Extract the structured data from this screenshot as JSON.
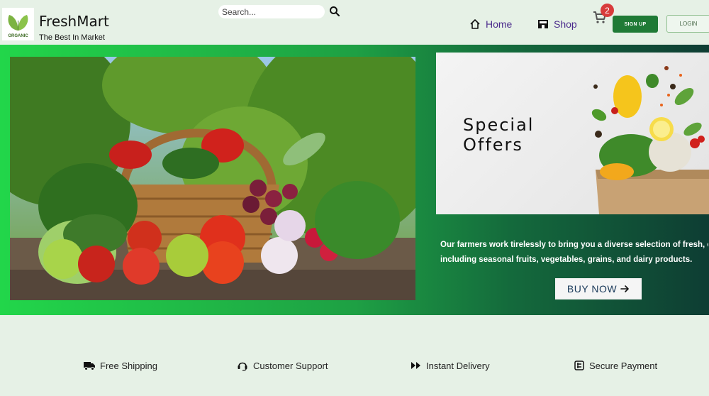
{
  "brand": {
    "name": "FreshMart",
    "tagline": "The Best In Market",
    "logo_text": "ORGANIC"
  },
  "search": {
    "placeholder": "Search...",
    "value": ""
  },
  "nav": {
    "home": "Home",
    "shop": "Shop"
  },
  "cart": {
    "count": "2"
  },
  "auth": {
    "signup": "SIGN UP",
    "login": "LOGIN"
  },
  "hero": {
    "offer_title": [
      "Special",
      "Offers"
    ],
    "description": [
      "Our farmers work tirelessly to bring you a diverse selection of fresh, organic",
      "including seasonal fruits, vegetables, grains, and dairy products."
    ],
    "cta": "BUY NOW"
  },
  "features": [
    {
      "icon": "truck-icon",
      "label": "Free Shipping"
    },
    {
      "icon": "headset-icon",
      "label": "Customer Support"
    },
    {
      "icon": "fast-forward-icon",
      "label": "Instant Delivery"
    },
    {
      "icon": "secure-payment-icon",
      "label": "Secure Payment"
    }
  ],
  "colors": {
    "accent": "#1f7a36",
    "nav_text": "#4b2b8c",
    "badge": "#d83b3b",
    "hero_start": "#22d64a",
    "hero_end": "#0e3d33"
  }
}
